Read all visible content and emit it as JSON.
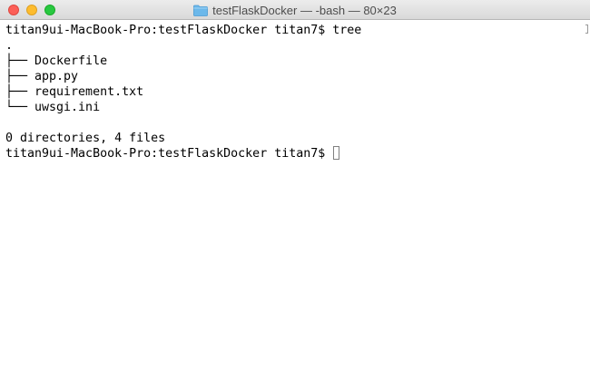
{
  "window": {
    "title": "testFlaskDocker — -bash — 80×23"
  },
  "terminal": {
    "lines": [
      "titan9ui-MacBook-Pro:testFlaskDocker titan7$ tree",
      ".",
      "├── Dockerfile",
      "├── app.py",
      "├── requirement.txt",
      "└── uwsgi.ini",
      "",
      "0 directories, 4 files"
    ],
    "prompt": "titan9ui-MacBook-Pro:testFlaskDocker titan7$ "
  },
  "colors": {
    "folder_icon": "#6cb8ea"
  }
}
